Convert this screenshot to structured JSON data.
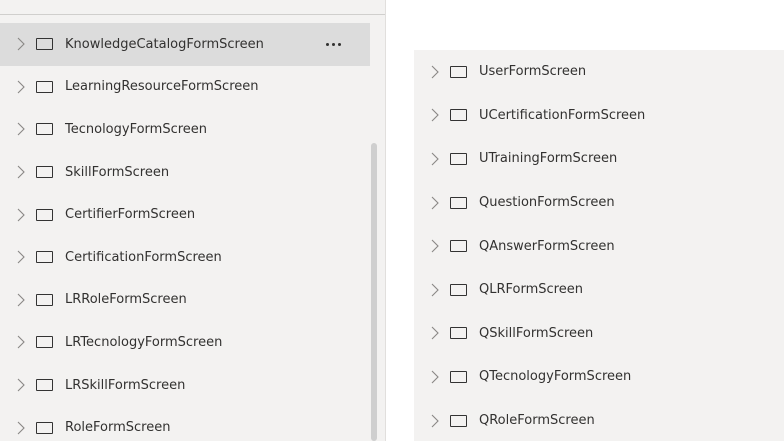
{
  "left_tree": {
    "items": [
      {
        "label": "KnowledgeCatalogFormScreen",
        "selected": true,
        "icon": "screen-icon"
      },
      {
        "label": "LearningResourceFormScreen",
        "icon": "screen-icon"
      },
      {
        "label": "TecnologyFormScreen",
        "icon": "screen-icon"
      },
      {
        "label": "SkillFormScreen",
        "icon": "screen-icon"
      },
      {
        "label": "CertifierFormScreen",
        "icon": "screen-icon"
      },
      {
        "label": "CertificationFormScreen",
        "icon": "screen-icon"
      },
      {
        "label": "LRRoleFormScreen",
        "icon": "screen-icon"
      },
      {
        "label": "LRTecnologyFormScreen",
        "icon": "screen-icon"
      },
      {
        "label": "LRSkillFormScreen",
        "icon": "screen-icon"
      },
      {
        "label": "RoleFormScreen",
        "icon": "screen-icon"
      }
    ],
    "more_icon": "ellipsis-icon"
  },
  "right_tree": {
    "items": [
      {
        "label": "UserFormScreen",
        "icon": "screen-icon"
      },
      {
        "label": "UCertificationFormScreen",
        "icon": "screen-icon"
      },
      {
        "label": "UTrainingFormScreen",
        "icon": "screen-icon"
      },
      {
        "label": "QuestionFormScreen",
        "icon": "screen-icon"
      },
      {
        "label": "QAnswerFormScreen",
        "icon": "screen-icon"
      },
      {
        "label": "QLRFormScreen",
        "icon": "screen-icon"
      },
      {
        "label": "QSkillFormScreen",
        "icon": "screen-icon"
      },
      {
        "label": "QTecnologyFormScreen",
        "icon": "screen-icon"
      },
      {
        "label": "QRoleFormScreen",
        "icon": "screen-icon"
      }
    ]
  },
  "colors": {
    "panel_bg": "#f3f2f1",
    "selected_bg": "#dcdcdc",
    "text": "#323130",
    "chevron": "#8a8886",
    "scrollbar": "#cfcfcf"
  }
}
